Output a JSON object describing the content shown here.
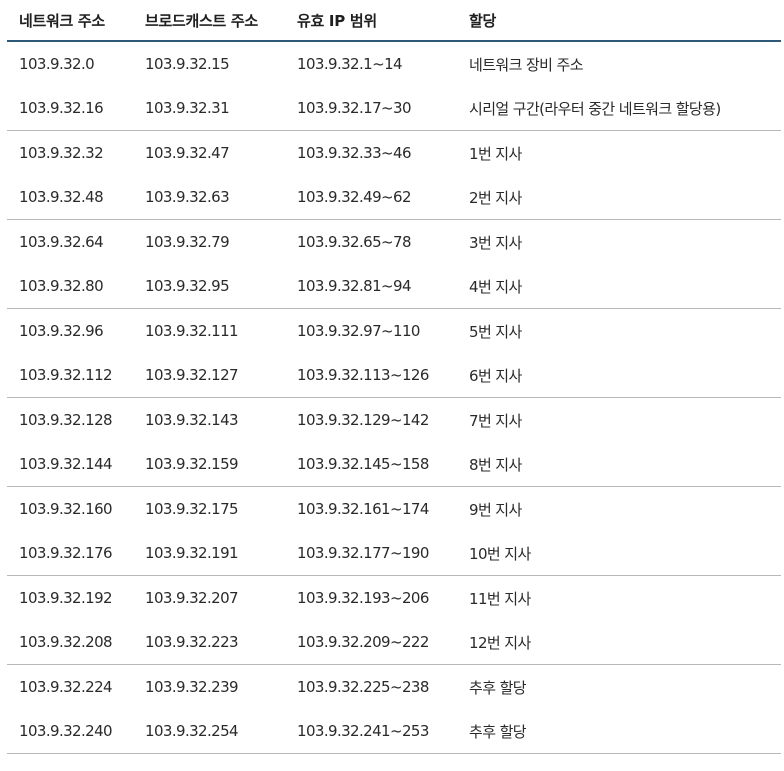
{
  "table": {
    "headers": [
      "네트워크 주소",
      "브로드캐스트 주소",
      "유효 IP 범위",
      "할당"
    ],
    "rows": [
      {
        "network": "103.9.32.0",
        "broadcast": "103.9.32.15",
        "range": "103.9.32.1~14",
        "allocation": "네트워크 장비 주소"
      },
      {
        "network": "103.9.32.16",
        "broadcast": "103.9.32.31",
        "range": "103.9.32.17~30",
        "allocation": "시리얼 구간(라우터 중간 네트워크 할당용)"
      },
      {
        "network": "103.9.32.32",
        "broadcast": "103.9.32.47",
        "range": "103.9.32.33~46",
        "allocation": "1번 지사"
      },
      {
        "network": "103.9.32.48",
        "broadcast": "103.9.32.63",
        "range": "103.9.32.49~62",
        "allocation": "2번 지사"
      },
      {
        "network": "103.9.32.64",
        "broadcast": "103.9.32.79",
        "range": "103.9.32.65~78",
        "allocation": "3번 지사"
      },
      {
        "network": "103.9.32.80",
        "broadcast": "103.9.32.95",
        "range": "103.9.32.81~94",
        "allocation": "4번 지사"
      },
      {
        "network": "103.9.32.96",
        "broadcast": "103.9.32.111",
        "range": "103.9.32.97~110",
        "allocation": "5번 지사"
      },
      {
        "network": "103.9.32.112",
        "broadcast": "103.9.32.127",
        "range": "103.9.32.113~126",
        "allocation": "6번 지사"
      },
      {
        "network": "103.9.32.128",
        "broadcast": "103.9.32.143",
        "range": "103.9.32.129~142",
        "allocation": "7번 지사"
      },
      {
        "network": "103.9.32.144",
        "broadcast": "103.9.32.159",
        "range": "103.9.32.145~158",
        "allocation": "8번 지사"
      },
      {
        "network": "103.9.32.160",
        "broadcast": "103.9.32.175",
        "range": "103.9.32.161~174",
        "allocation": "9번 지사"
      },
      {
        "network": "103.9.32.176",
        "broadcast": "103.9.32.191",
        "range": "103.9.32.177~190",
        "allocation": "10번 지사"
      },
      {
        "network": "103.9.32.192",
        "broadcast": "103.9.32.207",
        "range": "103.9.32.193~206",
        "allocation": "11번 지사"
      },
      {
        "network": "103.9.32.208",
        "broadcast": "103.9.32.223",
        "range": "103.9.32.209~222",
        "allocation": "12번 지사"
      },
      {
        "network": "103.9.32.224",
        "broadcast": "103.9.32.239",
        "range": "103.9.32.225~238",
        "allocation": "추후 할당"
      },
      {
        "network": "103.9.32.240",
        "broadcast": "103.9.32.254",
        "range": "103.9.32.241~253",
        "allocation": "추후 할당"
      }
    ]
  }
}
